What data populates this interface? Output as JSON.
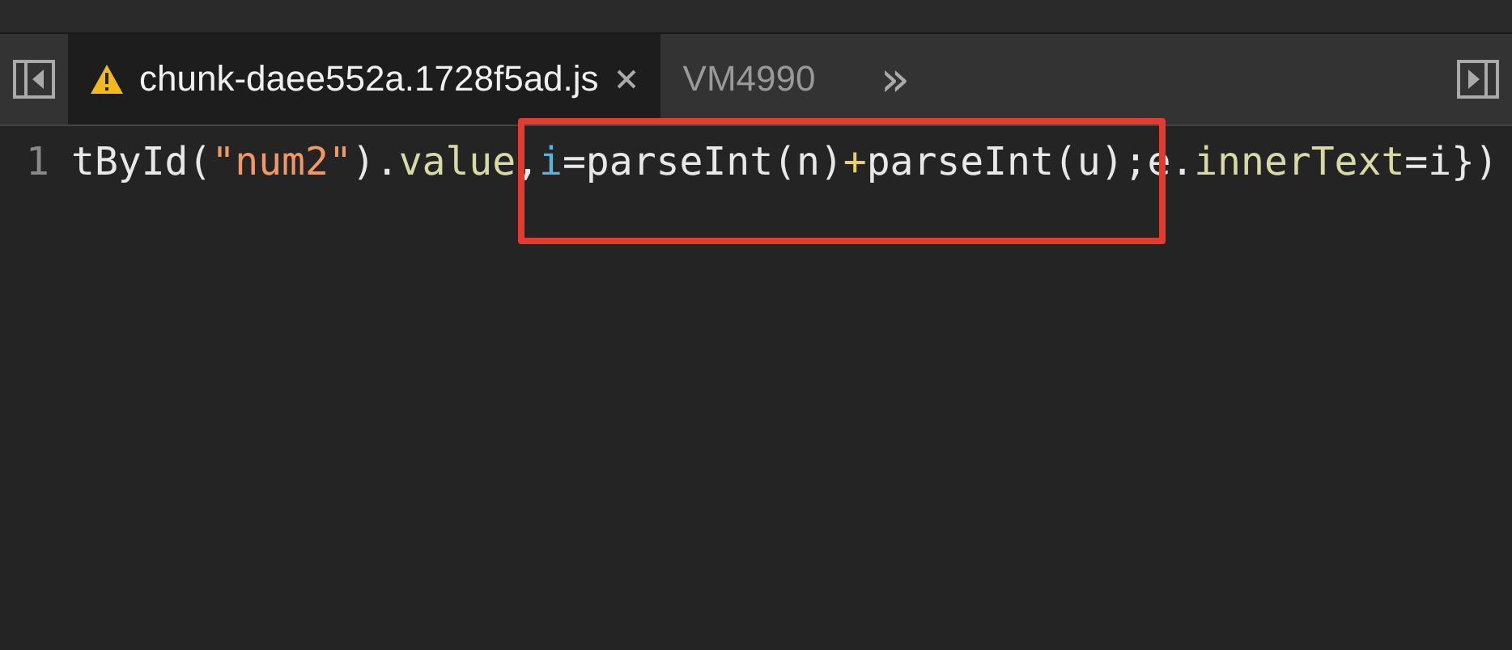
{
  "tabs": [
    {
      "label": "chunk-daee552a.1728f5ad.js",
      "warning": true,
      "closable": true,
      "selected": true
    },
    {
      "label": "VM4990",
      "warning": false,
      "closable": false,
      "selected": false
    }
  ],
  "more_tabs": "»",
  "editor": {
    "line_number": "1",
    "tokens": [
      {
        "text": "tById(",
        "kind": "plain"
      },
      {
        "text": "\"num2\"",
        "kind": "string"
      },
      {
        "text": ").",
        "kind": "plain"
      },
      {
        "text": "value",
        "kind": "prop"
      },
      {
        "text": ",",
        "kind": "plain"
      },
      {
        "text": "i",
        "kind": "var"
      },
      {
        "text": "=parseInt(n)",
        "kind": "plain"
      },
      {
        "text": "+",
        "kind": "op"
      },
      {
        "text": "parseInt(u);e.",
        "kind": "plain"
      },
      {
        "text": "innerText",
        "kind": "prop"
      },
      {
        "text": "=i})",
        "kind": "plain"
      }
    ]
  }
}
